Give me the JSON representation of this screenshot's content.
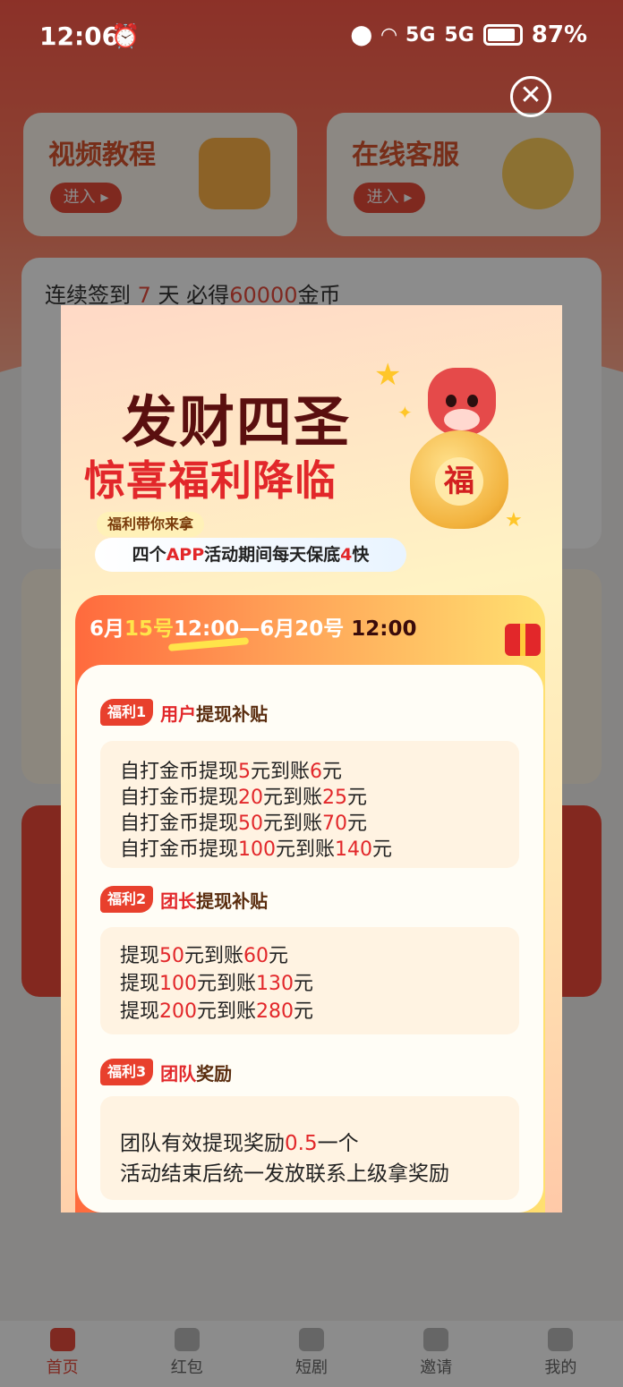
{
  "status_bar": {
    "time": "12:06",
    "network_1": "5G",
    "network_2": "5G",
    "battery": "87%"
  },
  "app": {
    "cards": [
      {
        "title": "视频教程",
        "enter": "进入 ▸"
      },
      {
        "title": "在线客服",
        "enter": "进入 ▸"
      }
    ],
    "sign": {
      "prefix": "连续签到 ",
      "days": "7",
      "mid": " 天 必得",
      "coins": "60000",
      "suffix": "金币"
    },
    "tabs": [
      "首页",
      "红包",
      "短剧",
      "邀请",
      "我的"
    ]
  },
  "popup": {
    "close_glyph": "✕",
    "title_line1": "发财四圣",
    "title_line2": "惊喜福利降临",
    "tag_small": "福利带你来拿",
    "tag_big": {
      "p1": "四个",
      "p2": "APP",
      "p3": "活动期间每天保底",
      "p4": "4",
      "p5": "快"
    },
    "date": {
      "p1": "6月",
      "p2": "15号",
      "p3": "12:00—6月20号",
      "p4": " 12:00"
    },
    "bag_char": "福",
    "sections": [
      {
        "tag": "福利1",
        "title_a": "用户",
        "title_b": "提现补贴",
        "lines": [
          {
            "a": "自打金币提现",
            "b": "5",
            "c": "元到账",
            "d": "6",
            "e": "元"
          },
          {
            "a": "自打金币提现",
            "b": "20",
            "c": "元到账",
            "d": "25",
            "e": "元"
          },
          {
            "a": "自打金币提现",
            "b": "50",
            "c": "元到账",
            "d": "70",
            "e": "元"
          },
          {
            "a": "自打金币提现",
            "b": "100",
            "c": "元到账",
            "d": "140",
            "e": "元"
          }
        ]
      },
      {
        "tag": "福利2",
        "title_a": "团长",
        "title_b": "提现补贴",
        "lines": [
          {
            "a": "提现",
            "b": "50",
            "c": "元到账",
            "d": "60",
            "e": "元"
          },
          {
            "a": "提现",
            "b": "100",
            "c": "元到账",
            "d": "130",
            "e": "元"
          },
          {
            "a": "提现",
            "b": "200",
            "c": "元到账",
            "d": "280",
            "e": "元"
          }
        ]
      },
      {
        "tag": "福利3",
        "title_a": "团队",
        "title_b": "奖励",
        "lines": [
          {
            "a": "团队有效提现奖励",
            "b": "0.5",
            "c": "一个"
          },
          {
            "a": "活动结束后统一发放联系上级拿奖励"
          }
        ]
      }
    ]
  },
  "icons": [
    "alarm-icon",
    "location-icon",
    "wifi-icon",
    "signal-icon",
    "battery-icon",
    "close-icon",
    "play-icon",
    "gift-icon",
    "home-icon"
  ],
  "colors": {
    "accent_red": "#e2272a",
    "title_dark": "#5a0f0f",
    "sign_red": "#e74c3c"
  }
}
